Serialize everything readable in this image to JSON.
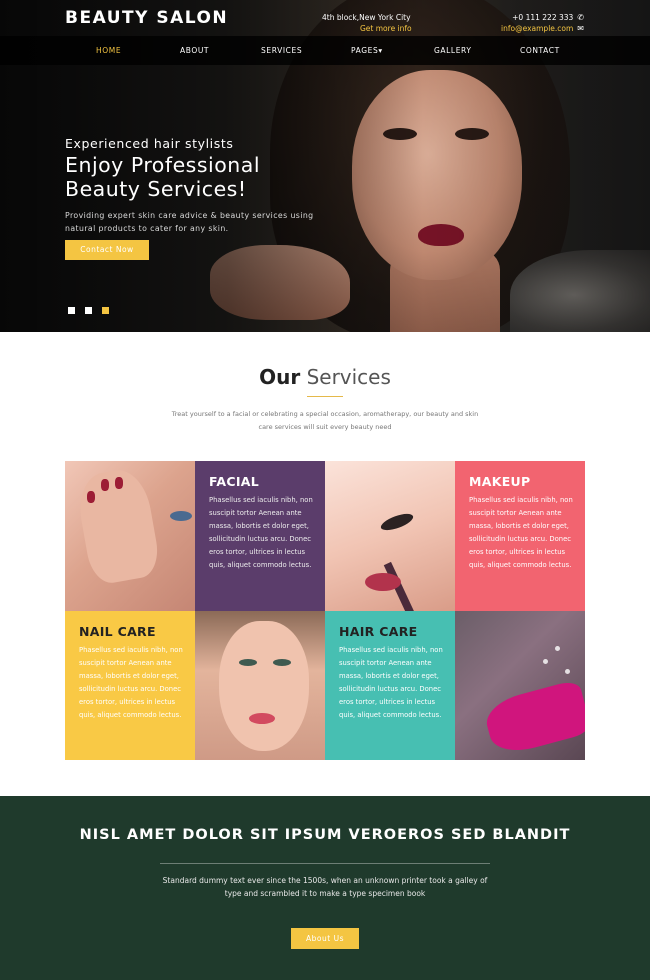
{
  "header": {
    "logo": "BEAUTY SALON",
    "address": "4th block,New York City",
    "more_info_link": "Get more info",
    "phone": "+0 111 222 333",
    "email": "info@example.com",
    "phone_icon": "phone-icon",
    "email_icon": "envelope-icon"
  },
  "nav": {
    "items": [
      {
        "label": "HOME",
        "active": true
      },
      {
        "label": "ABOUT"
      },
      {
        "label": "SERVICES"
      },
      {
        "label": "PAGES▾"
      },
      {
        "label": "GALLERY"
      },
      {
        "label": "CONTACT"
      }
    ]
  },
  "hero": {
    "subtitle": "Experienced hair stylists",
    "title_line1": "Enjoy Professional",
    "title_line2": "Beauty Services!",
    "description": "Providing expert skin care advice & beauty services using natural products to cater for any skin.",
    "button": "Contact Now",
    "slides": 3,
    "active_slide": 3
  },
  "services": {
    "title_bold": "Our",
    "title_light": "Services",
    "intro": "Treat yourself to a facial or celebrating a special occasion, aromatherapy, our beauty and skin care services will suit every beauty need",
    "cards": [
      {
        "title": "FACIAL",
        "text": "Phasellus sed iaculis nibh, non suscipit tortor Aenean ante massa, lobortis et dolor eget, sollicitudin luctus arcu. Donec eros tortor, ultrices in lectus quis, aliquet commodo lectus."
      },
      {
        "title": "MAKEUP",
        "text": "Phasellus sed iaculis nibh, non suscipit tortor Aenean ante massa, lobortis et dolor eget, sollicitudin luctus arcu. Donec eros tortor, ultrices in lectus quis, aliquet commodo lectus."
      },
      {
        "title": "NAIL CARE",
        "text": "Phasellus sed iaculis nibh, non suscipit tortor Aenean ante massa, lobortis et dolor eget, sollicitudin luctus arcu. Donec eros tortor, ultrices in lectus quis, aliquet commodo lectus."
      },
      {
        "title": "HAIR CARE",
        "text": "Phasellus sed iaculis nibh, non suscipit tortor Aenean ante massa, lobortis et dolor eget, sollicitudin luctus arcu. Donec eros tortor, ultrices in lectus quis, aliquet commodo lectus."
      }
    ]
  },
  "banner": {
    "title": "NISL AMET DOLOR SIT IPSUM VEROEROS SED BLANDIT",
    "text": "Standard dummy text ever since the 1500s, when an unknown printer took a galley of type and scrambled it to make a type specimen book",
    "button": "About Us"
  },
  "colors": {
    "accent": "#f4c542",
    "facial": "#5b3d6b",
    "makeup": "#f26470",
    "nail": "#f9c945",
    "hair": "#47bfb2",
    "banner": "#1f3a2c"
  }
}
